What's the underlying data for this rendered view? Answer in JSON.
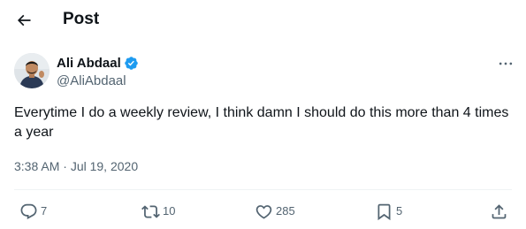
{
  "header": {
    "title": "Post"
  },
  "tweet": {
    "author_name": "Ali Abdaal",
    "author_handle": "@AliAbdaal",
    "text": "Everytime I do a weekly review, I think damn I should do this more than 4 times a year",
    "time": "3:38 AM",
    "separator": "·",
    "date": "Jul 19, 2020"
  },
  "actions": {
    "replies": "7",
    "reposts": "10",
    "likes": "285",
    "bookmarks": "5"
  },
  "colors": {
    "text_primary": "#0f1419",
    "text_secondary": "#536471",
    "verified_blue": "#1d9bf0",
    "divider": "#eff3f4"
  },
  "icons": {
    "back": "arrow-left-icon",
    "verified": "verified-badge-icon",
    "more": "more-horizontal-icon",
    "reply": "reply-icon",
    "repost": "repost-icon",
    "like": "heart-icon",
    "bookmark": "bookmark-icon",
    "share": "share-icon"
  }
}
